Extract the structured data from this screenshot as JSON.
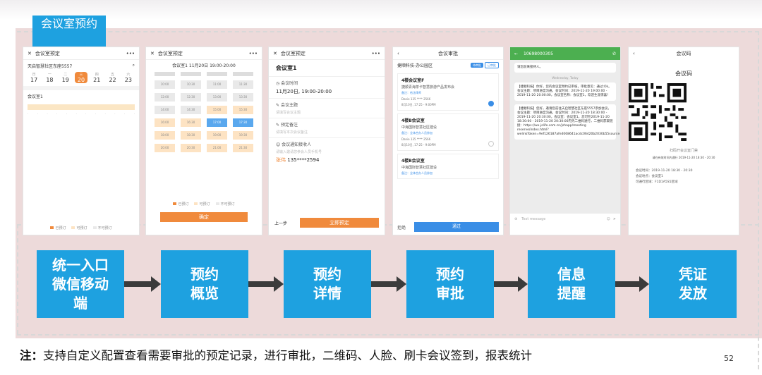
{
  "title": "会议室预约",
  "panel1": {
    "header": "会议室预定",
    "location": "天启智慧社区东座5557",
    "days": [
      {
        "w": "日",
        "d": "17"
      },
      {
        "w": "一",
        "d": "18"
      },
      {
        "w": "二",
        "d": "19"
      },
      {
        "w": "三",
        "d": "20"
      },
      {
        "w": "四",
        "d": "21"
      },
      {
        "w": "五",
        "d": "22"
      },
      {
        "w": "六",
        "d": "23"
      }
    ],
    "room": "会议室1",
    "legend": [
      "已预订",
      "可预订",
      "不可预订"
    ]
  },
  "panel2": {
    "header": "会议室预定",
    "subtitle": "会议室1  11月20日 19:00-20:00",
    "cells": [
      "10:00",
      "10:30",
      "11:00",
      "11:30",
      "12:00",
      "12:30",
      "13:00",
      "13:30",
      "14:00",
      "14:30",
      "15:00",
      "15:30",
      "16:00",
      "16:30",
      "17:00",
      "17:30",
      "18:00",
      "18:30",
      "19:00",
      "19:30",
      "20:00",
      "20:30",
      "21:00",
      "21:30",
      "22:00",
      "22:30",
      "23:00",
      "23:30"
    ],
    "legend": [
      "已预订",
      "可预订",
      "不可预订"
    ],
    "button": "确定"
  },
  "panel3": {
    "header": "会议室预定",
    "room": "会议室1",
    "fields": [
      {
        "label": "会议时间",
        "value": "11月20日, 19:00-20:00"
      },
      {
        "label": "会议主题",
        "value": "请填写会议主题"
      },
      {
        "label": "预定备注",
        "value": "请填写本次会议备注"
      },
      {
        "label": "会议通知接收人",
        "value": "请输入邀请您参会人员手机号"
      }
    ],
    "contact_name": "张伟",
    "contact_phone": "135****2594",
    "prev": "上一步",
    "submit": "立即预定"
  },
  "panel4": {
    "header": "会议审批",
    "filter": "捷顺科技-办公园区",
    "tab_pending": "待审批",
    "tab_done": "已审批",
    "cards": [
      {
        "title": "4楼会议室F",
        "sub": "捷顺青海茶卡智慧旅游产品发布会",
        "remark": "备注：给法律师",
        "meta1": "Danie   135 **** 2566",
        "meta2": "8月10日, 17:25 - 9:00PM"
      },
      {
        "title": "4楼B会议室",
        "sub": "中海国际智慧社区建设",
        "remark": "备注：全体合办人员参加",
        "meta1": "Danie   135 **** 2566",
        "meta2": "8月10日, 17:25 - 9:00PM"
      },
      {
        "title": "4楼B会议室",
        "sub": "中海国际智慧社区建设",
        "remark": "备注：全体合办人员参加",
        "meta1": "",
        "meta2": ""
      }
    ],
    "reject": "拒绝",
    "approve": "通过"
  },
  "panel5": {
    "number": "10698000305",
    "top_text": "请您前来接待人。",
    "date": "Wednesday, Today",
    "msg1": "【捷顺科技】你好，您的会议室预约已审核，审批意见：通过:Ok。会议主题：项目进度沟通，会议时间：2019-11-20 19:00:00 - 2019-11-20 20:00:00，会议室名称：会议室1，欢迎生涯惊喜！",
    "msg2": "【捷顺科技】您好，邀请您前往天启智慧社区东座5557参加会议，会议主题：项目进度沟通，会议时间：2019-11-20 18:30:00 - 2019-11-20 20:30:00，会议室：会议室1，您可在2019-11-20 18:30:00 - 2019-11-20 20:30:00内凭二维码通行，二维码获取链接：https://wx.jslife.com.cn/jshapp/meeting reserve/index.html?welinkToken=9ef126187afe4068641acdc06420b2030b55source=WX_&bill=estomeInfold=764&ivisitorQrCode。",
    "input_placeholder": "Text message"
  },
  "panel6": {
    "header": "会议码",
    "title": "会议码",
    "caption": "扫码开会议室门禁",
    "valid": "请在有效时间内通行 2019-11-20 18:30 - 20:30",
    "info": [
      "会议时间：2019-11-20 18:30 - 20:30",
      "会议地点：会议室1",
      "可通行区域：F1D1A5S5区域"
    ]
  },
  "steps": [
    "统一入口\n微信移动\n端",
    "预约\n概览",
    "预约\n详情",
    "预约\n审批",
    "信息\n提醒",
    "凭证\n发放"
  ],
  "note_label": "注：",
  "note_text": "支持自定义配置查看需要审批的预定记录，进行审批，二维码、人脸、刷卡会议签到，报表统计",
  "page_number": "52",
  "colors": {
    "accent": "#1ea1e0",
    "orange": "#f08a3c",
    "blue": "#3a8ee6",
    "green": "#4caf50",
    "pink": "#eddada"
  }
}
